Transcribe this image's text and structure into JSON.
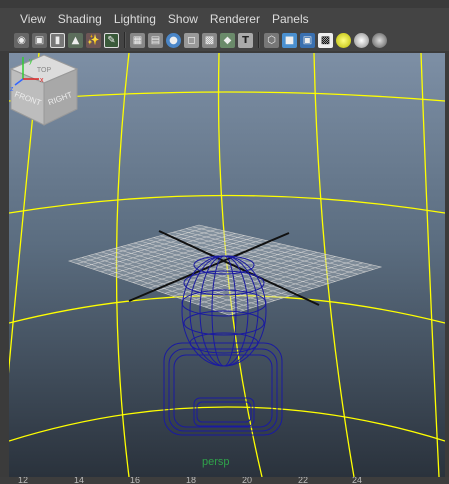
{
  "menu": [
    "View",
    "Shading",
    "Lighting",
    "Show",
    "Renderer",
    "Panels"
  ],
  "toolbar_icons": [
    "select-camera-icon",
    "camera-attributes-icon",
    "bookmark-icon",
    "image-plane-icon",
    "two-d-pan-zoom-icon",
    "grease-pencil-icon",
    "grid-icon",
    "film-gate-icon",
    "resolution-gate-icon",
    "gate-mask-icon",
    "field-chart-icon",
    "safe-title-icon",
    "wireframe-icon",
    "smooth-shade-icon",
    "textured-icon",
    "use-lights-icon",
    "shadows-icon",
    "ambient-occlusion-icon"
  ],
  "view_cube": {
    "front": "FRONT",
    "right": "RIGHT",
    "top": "TOP"
  },
  "camera_label": "persp",
  "ruler_ticks": [
    "12",
    "14",
    "16",
    "18",
    "20",
    "22",
    "24"
  ],
  "colors": {
    "grid": "#ffff00",
    "wire": "#1a1aa0",
    "camera_label": "#2fa24a"
  }
}
